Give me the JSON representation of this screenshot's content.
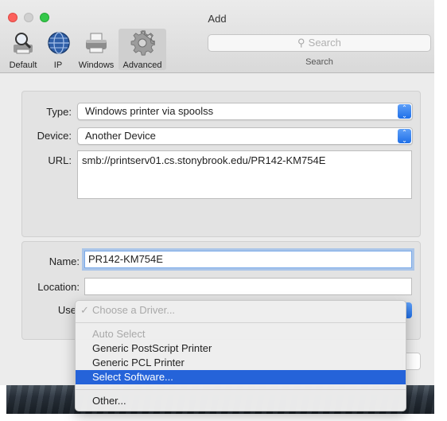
{
  "window": {
    "title": "Add"
  },
  "toolbar": {
    "tabs": [
      {
        "label": "Default",
        "icon": "magnifier-printer-icon"
      },
      {
        "label": "IP",
        "icon": "globe-icon"
      },
      {
        "label": "Windows",
        "icon": "printer-icon"
      },
      {
        "label": "Advanced",
        "icon": "gear-icon",
        "active": true
      }
    ],
    "search": {
      "placeholder": "Search",
      "caption": "Search"
    }
  },
  "form": {
    "type": {
      "label": "Type:",
      "value": "Windows printer via spoolss"
    },
    "device": {
      "label": "Device:",
      "value": "Another Device"
    },
    "url": {
      "label": "URL:",
      "value": "smb://printserv01.cs.stonybrook.edu/PR142-KM754E"
    },
    "name": {
      "label": "Name:",
      "value": "PR142-KM754E"
    },
    "location": {
      "label": "Location:",
      "value": ""
    },
    "use": {
      "label": "Use"
    }
  },
  "menu": {
    "header": "Choose a Driver...",
    "items": [
      {
        "label": "Auto Select",
        "disabled": true
      },
      {
        "label": "Generic PostScript Printer"
      },
      {
        "label": "Generic PCL Printer"
      },
      {
        "label": "Select Software...",
        "selected": true
      }
    ],
    "other": "Other..."
  },
  "colors": {
    "accent": "#2563d9",
    "close": "#fc605c",
    "maximize": "#34c84a"
  }
}
